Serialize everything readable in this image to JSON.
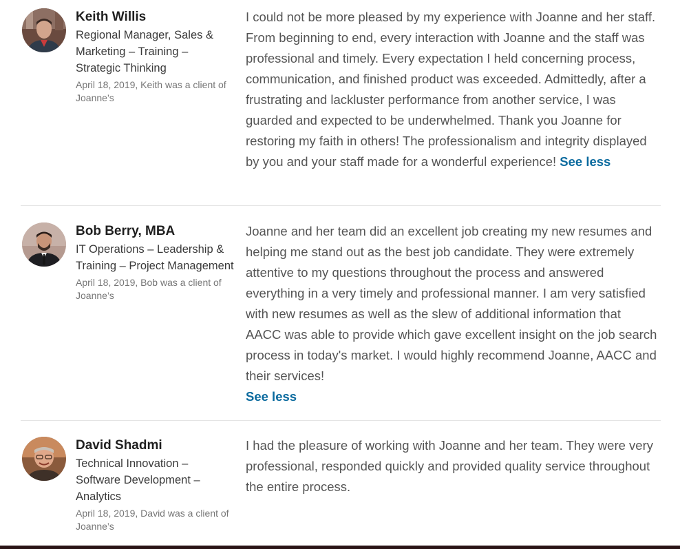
{
  "recommendations": [
    {
      "name": "Keith Willis",
      "headline": "Regional Manager, Sales & Marketing – Training – Strategic Thinking",
      "meta": "April 18, 2019, Keith was a client of Joanne’s",
      "text": "I could not be more pleased by my experience with Joanne and her staff. From beginning to end, every interaction with Joanne and the staff was professional and timely. Every expectation I held concerning process, communication, and finished product was exceeded. Admittedly, after a frustrating and lackluster performance from another service, I was guarded and expected to be underwhelmed. Thank you Joanne for restoring my faith in others! The professionalism and integrity displayed by you and your staff made for a wonderful experience!",
      "toggle": "See less"
    },
    {
      "name": "Bob Berry, MBA",
      "headline": "IT Operations – Leadership & Training – Project Management",
      "meta": "April 18, 2019, Bob was a client of Joanne’s",
      "text": "Joanne and her team did an excellent job creating my new resumes and helping me stand out as the best job candidate. They were extremely attentive to my questions throughout the process and answered everything in a very timely and professional manner. I am very satisfied with new resumes as well as the slew of additional information that AACC was able to provide which gave excellent insight on the job search process in today's market. I would highly recommend Joanne, AACC and their services!",
      "toggle": "See less"
    },
    {
      "name": "David Shadmi",
      "headline": "Technical Innovation – Software Development – Analytics",
      "meta": "April 18, 2019, David was a client of Joanne’s",
      "text": "I had the pleasure of working with Joanne and her team. They were very professional, responded quickly and provided quality service throughout the entire process."
    }
  ],
  "colors": {
    "link": "#0a6a9e",
    "body_text": "#555555",
    "name_text": "#1f1f1f",
    "meta_text": "#767676",
    "divider": "#e4e4e4",
    "bottom_bar": "#2a1416"
  }
}
